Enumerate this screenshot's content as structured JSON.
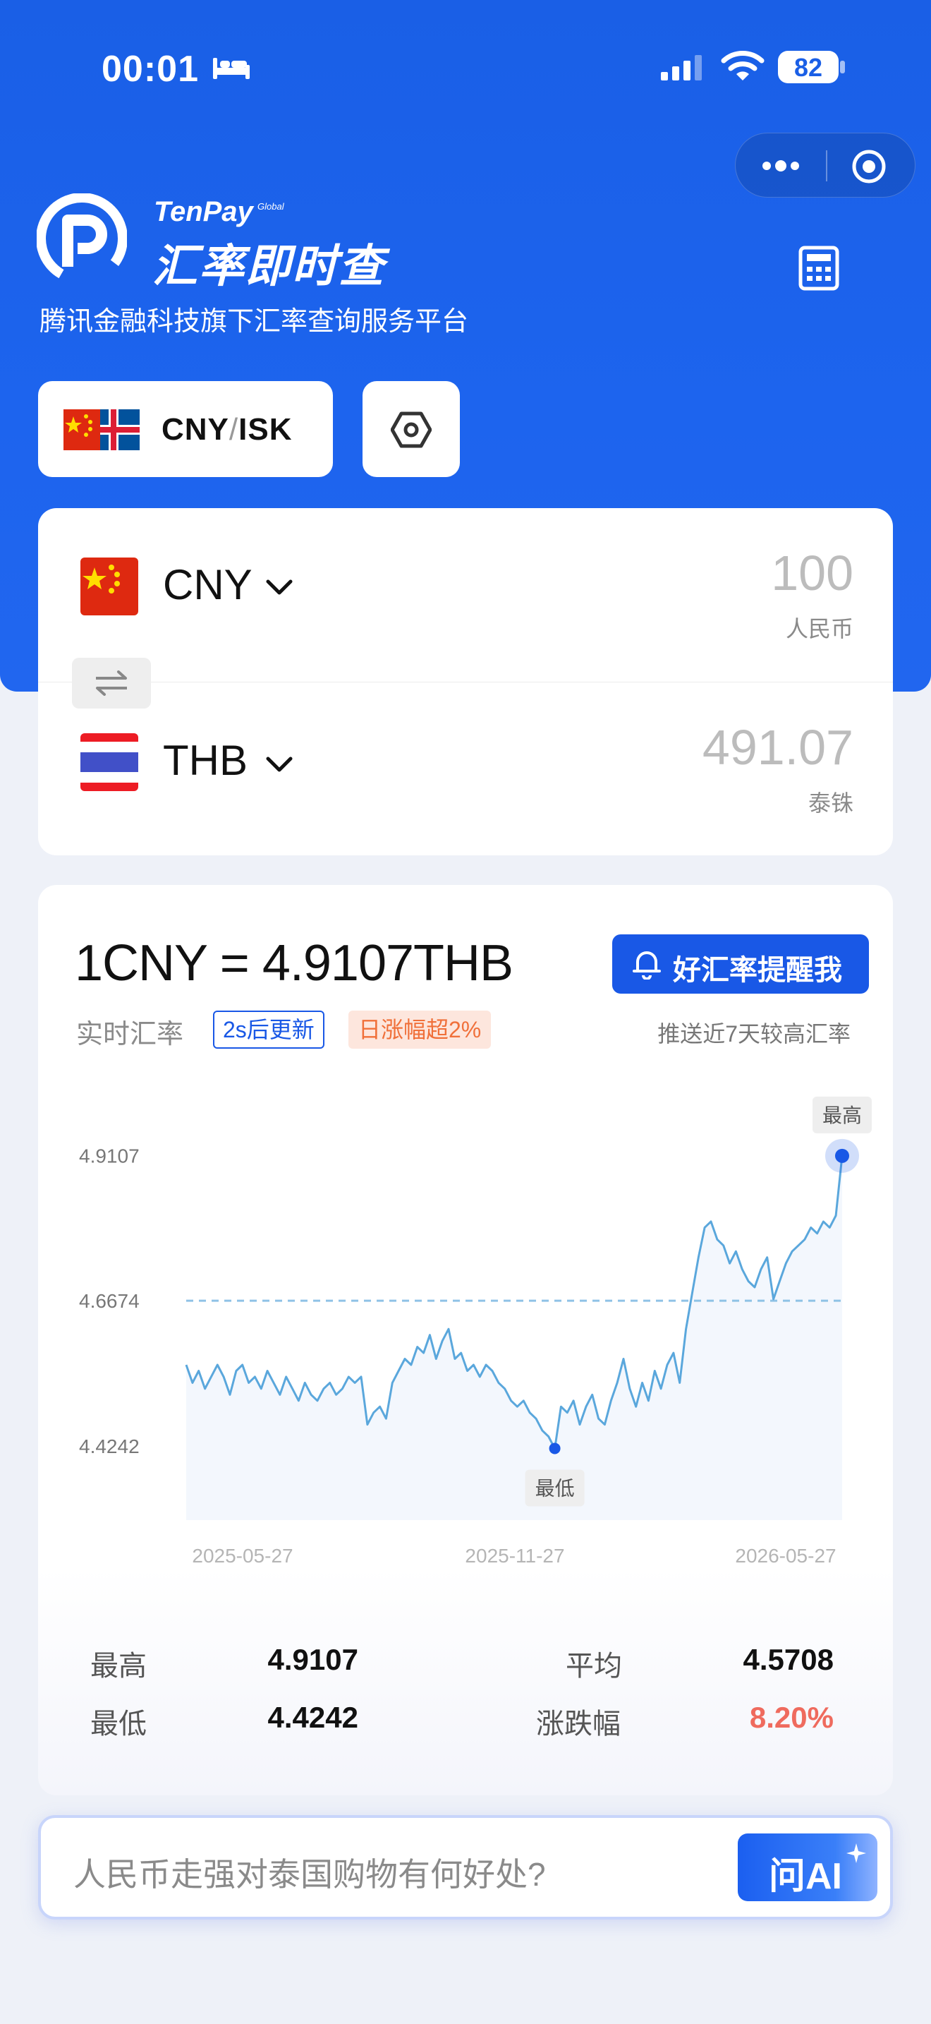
{
  "status_bar": {
    "time": "00:01",
    "battery": "82"
  },
  "brand": {
    "tenpay": "TenPay",
    "global": "Global",
    "title": "汇率即时查",
    "subtitle": "腾讯金融科技旗下汇率查询服务平台"
  },
  "pair": {
    "from": "CNY",
    "separator": "/",
    "to": "ISK"
  },
  "converter": {
    "from": {
      "code": "CNY",
      "amount": "100",
      "unit": "人民币"
    },
    "to": {
      "code": "THB",
      "amount": "491.07",
      "unit": "泰铢"
    }
  },
  "rate": {
    "headline": "1CNY = 4.9107THB",
    "alert_button": "好汇率提醒我",
    "live_label": "实时汇率",
    "update_badge": "2s后更新",
    "change_badge": "日涨幅超2%",
    "push_note": "推送近7天较高汇率"
  },
  "chart_data": {
    "type": "line",
    "y_ticks": [
      "4.9107",
      "4.6674",
      "4.4242"
    ],
    "x_ticks": [
      "2025-05-27",
      "2025-11-27",
      "2026-05-27"
    ],
    "ylim": [
      4.3,
      4.95
    ],
    "average_line": 4.6674,
    "max_label": "最高",
    "min_label": "最低",
    "colors": {
      "line": "#5aa7dc",
      "avg": "#8fc2e6",
      "marker": "#1958e6"
    },
    "values": [
      4.56,
      4.53,
      4.55,
      4.52,
      4.54,
      4.56,
      4.54,
      4.51,
      4.55,
      4.56,
      4.53,
      4.54,
      4.52,
      4.55,
      4.53,
      4.51,
      4.54,
      4.52,
      4.5,
      4.53,
      4.51,
      4.5,
      4.52,
      4.53,
      4.51,
      4.52,
      4.54,
      4.53,
      4.54,
      4.46,
      4.48,
      4.49,
      4.47,
      4.53,
      4.55,
      4.57,
      4.56,
      4.59,
      4.58,
      4.61,
      4.57,
      4.6,
      4.62,
      4.57,
      4.58,
      4.55,
      4.56,
      4.54,
      4.56,
      4.55,
      4.53,
      4.52,
      4.5,
      4.49,
      4.5,
      4.48,
      4.47,
      4.45,
      4.44,
      4.42,
      4.49,
      4.48,
      4.5,
      4.46,
      4.49,
      4.51,
      4.47,
      4.46,
      4.5,
      4.53,
      4.57,
      4.52,
      4.49,
      4.53,
      4.5,
      4.55,
      4.52,
      4.56,
      4.58,
      4.53,
      4.62,
      4.68,
      4.74,
      4.79,
      4.8,
      4.77,
      4.76,
      4.73,
      4.75,
      4.72,
      4.7,
      4.69,
      4.72,
      4.74,
      4.67,
      4.7,
      4.73,
      4.75,
      4.76,
      4.77,
      4.79,
      4.78,
      4.8,
      4.79,
      4.81,
      4.91
    ]
  },
  "stats": {
    "high_label": "最高",
    "high_value": "4.9107",
    "avg_label": "平均",
    "avg_value": "4.5708",
    "low_label": "最低",
    "low_value": "4.4242",
    "change_label": "涨跌幅",
    "change_value": "8.20%"
  },
  "ask": {
    "placeholder": "人民币走强对泰国购物有何好处?",
    "button": "问AI"
  },
  "icons": [
    "bed-icon",
    "signal-icon",
    "wifi-icon",
    "more-icon",
    "target-icon",
    "tenpay-logo-icon",
    "calculator-icon",
    "hexagon-settings-icon",
    "chevron-down-icon",
    "swap-icon",
    "bell-icon",
    "sparkle-icon"
  ]
}
